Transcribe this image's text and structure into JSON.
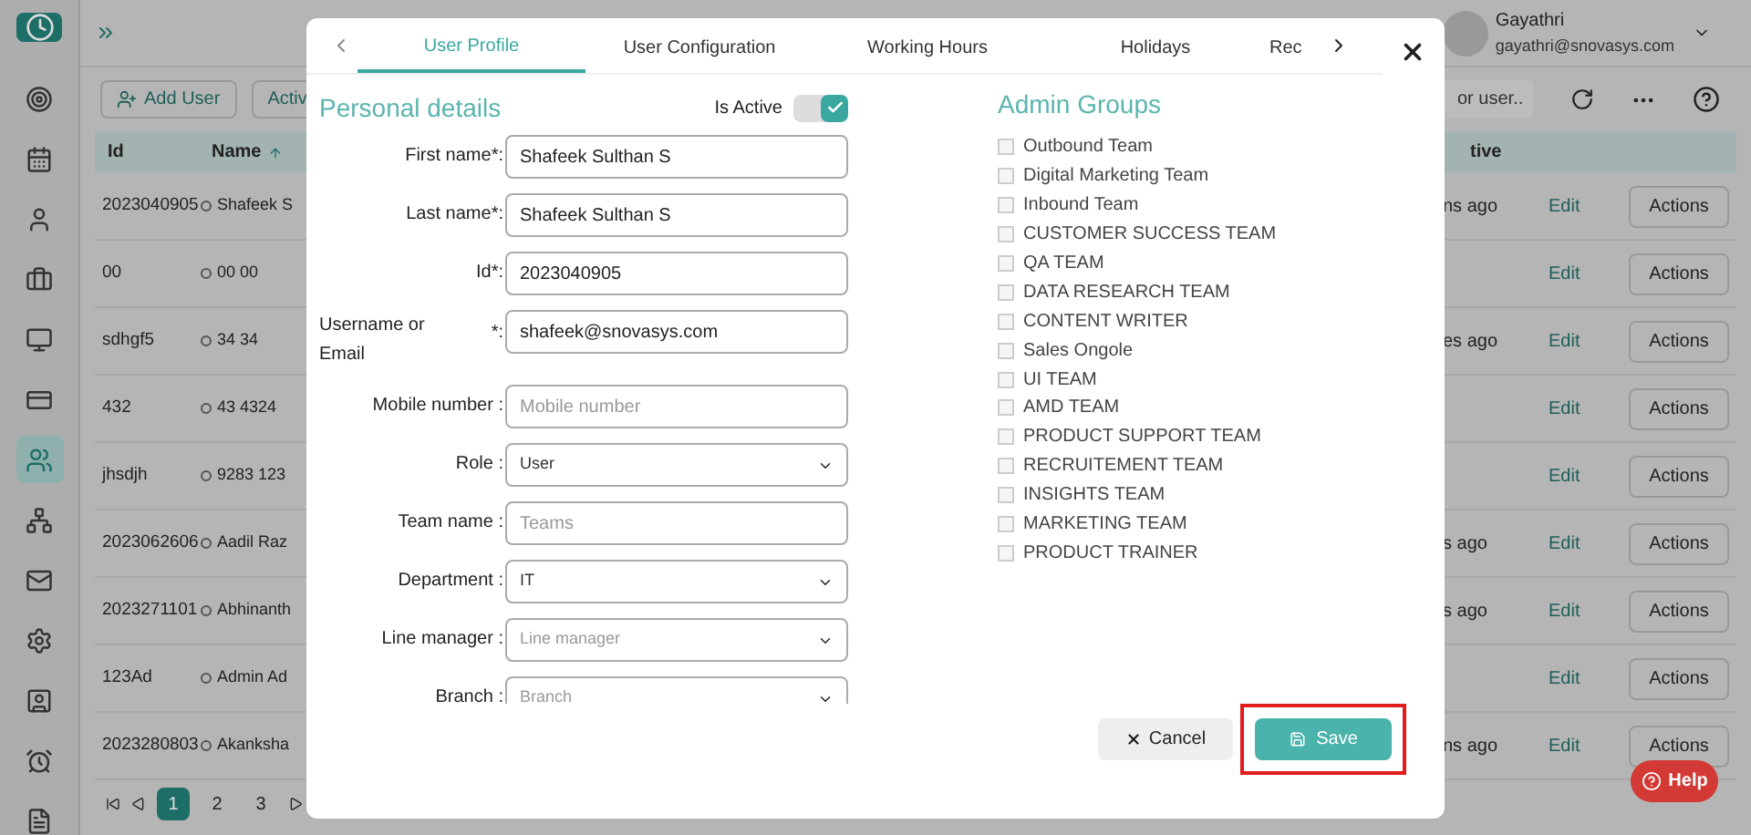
{
  "header": {
    "user_name": "Gayathri",
    "user_email": "gayathri@snovasys.com"
  },
  "sidebar": {
    "items": [
      {
        "selected": false
      },
      {
        "selected": false
      },
      {
        "selected": false
      },
      {
        "selected": false
      },
      {
        "selected": false
      },
      {
        "selected": false
      },
      {
        "selected": true
      },
      {
        "selected": false
      },
      {
        "selected": false
      },
      {
        "selected": false
      },
      {
        "selected": false
      },
      {
        "selected": false
      },
      {
        "selected": false
      }
    ]
  },
  "toolbar": {
    "add_user": "Add User",
    "active_filter": "Activ",
    "search_placeholder": "or user.."
  },
  "table": {
    "columns": [
      "Id",
      "Name",
      "tive"
    ],
    "rows": [
      {
        "id": "2023040905",
        "name": "Shafeek S",
        "column_3": "ns ago",
        "edit": "Edit",
        "actions": "Actions"
      },
      {
        "id": "00",
        "name": "00 00",
        "column_3": "",
        "edit": "Edit",
        "actions": "Actions"
      },
      {
        "id": "sdhgf5",
        "name": "34 34",
        "column_3": "es ago",
        "edit": "Edit",
        "actions": "Actions"
      },
      {
        "id": "432",
        "name": "43 4324",
        "column_3": "",
        "edit": "Edit",
        "actions": "Actions"
      },
      {
        "id": "jhsdjh",
        "name": "9283 123",
        "column_3": "",
        "edit": "Edit",
        "actions": "Actions"
      },
      {
        "id": "2023062606",
        "name": "Aadil Raz",
        "column_3": "s ago",
        "edit": "Edit",
        "actions": "Actions"
      },
      {
        "id": "2023271101",
        "name": "Abhinanth",
        "column_3": "s ago",
        "edit": "Edit",
        "actions": "Actions"
      },
      {
        "id": "123Ad",
        "name": "Admin Ad",
        "column_3": "",
        "edit": "Edit",
        "actions": "Actions"
      },
      {
        "id": "2023280803",
        "name": "Akanksha",
        "column_3": "ns ago",
        "edit": "Edit",
        "actions": "Actions"
      }
    ]
  },
  "pagination": {
    "pages": [
      {
        "label": "1",
        "selected": true
      },
      {
        "label": "2",
        "selected": false
      },
      {
        "label": "3",
        "selected": false
      }
    ]
  },
  "help_button": "Help",
  "dialog": {
    "tabs": [
      {
        "label": "User Profile",
        "selected": true
      },
      {
        "label": "User Configuration",
        "selected": false
      },
      {
        "label": "Working Hours",
        "selected": false
      },
      {
        "label": "Holidays",
        "selected": false
      },
      {
        "label": "Rec",
        "selected": false
      }
    ],
    "section_title": "Personal details",
    "is_active_label": "Is Active",
    "is_active": true,
    "fields": [
      {
        "label": "First name*:",
        "kind": "text",
        "value": "Shafeek Sulthan S"
      },
      {
        "label": "Last name*:",
        "kind": "text",
        "value": "Shafeek Sulthan S"
      },
      {
        "label": "Id*:",
        "kind": "text",
        "value": "2023040905"
      },
      {
        "label": "Username or Email",
        "required_mark": "*:",
        "kind": "text",
        "value": "shafeek@snovasys.com"
      },
      {
        "label": "Mobile number :",
        "kind": "text",
        "placeholder": "Mobile number"
      },
      {
        "label": "Role :",
        "kind": "select",
        "value": "User"
      },
      {
        "label": "Team name :",
        "kind": "text",
        "placeholder": "Teams"
      },
      {
        "label": "Department :",
        "kind": "select",
        "value": "IT"
      },
      {
        "label": "Line manager :",
        "kind": "select",
        "placeholder": "Line manager"
      },
      {
        "label": "Branch :",
        "kind": "select",
        "placeholder": "Branch"
      }
    ],
    "admin_groups_title": "Admin Groups",
    "admin_groups": [
      {
        "label": "Outbound Team",
        "checked": false
      },
      {
        "label": "Digital Marketing Team",
        "checked": false
      },
      {
        "label": "Inbound Team",
        "checked": false
      },
      {
        "label": "CUSTOMER SUCCESS TEAM",
        "checked": false
      },
      {
        "label": "QA TEAM",
        "checked": false
      },
      {
        "label": "DATA RESEARCH TEAM",
        "checked": false
      },
      {
        "label": "CONTENT WRITER",
        "checked": false
      },
      {
        "label": "Sales Ongole",
        "checked": false
      },
      {
        "label": "UI TEAM",
        "checked": false
      },
      {
        "label": "AMD TEAM",
        "checked": false
      },
      {
        "label": "PRODUCT SUPPORT TEAM",
        "checked": false
      },
      {
        "label": "RECRUITEMENT TEAM",
        "checked": false
      },
      {
        "label": "INSIGHTS TEAM",
        "checked": false
      },
      {
        "label": "MARKETING TEAM",
        "checked": false
      },
      {
        "label": "PRODUCT TRAINER",
        "checked": false
      }
    ],
    "cancel": "Cancel",
    "save": "Save",
    "save_highlighted": true
  }
}
